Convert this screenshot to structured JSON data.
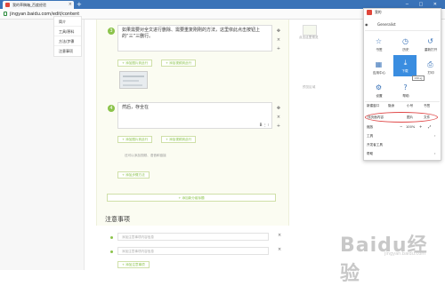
{
  "browser": {
    "tab_title": "我的草稿箱_百度经验",
    "new_tab": "+",
    "url": "jingyan.baidu.com/edit/content",
    "window_controls": "─ □ ✕"
  },
  "left_nav": {
    "items": [
      "简介",
      "工具/原料",
      "方法/步骤",
      "注意事项"
    ]
  },
  "steps": [
    {
      "num": "3",
      "text": "如果需要对全文进行删除、需要重复刚刚的方法，这里依此点击按钮上的“三”三删行。"
    },
    {
      "num": "4",
      "text": "然后，存全在"
    }
  ],
  "buttons": {
    "add_image": "+ 添加图片到此行",
    "add_video": "+ 添加视频到此行",
    "add_step": "+ 添加步骤方法",
    "add_section": "+ 添加新分组标题"
  },
  "image_note": "还可以添加视频、语音和链接",
  "notes": {
    "title": "注意事项",
    "placeholder": "添加注意事项内容信息",
    "add_button": "+ 添加注意事项"
  },
  "right_strip": {
    "label": "点击这里预览",
    "preview": "预览区域"
  },
  "menu": {
    "user": "Generalist",
    "top_label": "我的",
    "grid": [
      {
        "icon": "star-icon",
        "glyph": "☆",
        "label": "书签"
      },
      {
        "icon": "history-icon",
        "glyph": "◷",
        "label": "历史"
      },
      {
        "icon": "reopen-icon",
        "glyph": "↺",
        "label": "重新打开"
      },
      {
        "icon": "app-icon",
        "glyph": "▦",
        "label": "应用中心"
      },
      {
        "icon": "download-icon",
        "glyph": "⤓",
        "label": "下载"
      },
      {
        "icon": "print-icon",
        "glyph": "⎙",
        "label": "打印"
      },
      {
        "icon": "settings-icon",
        "glyph": "⚙",
        "label": "设置"
      },
      {
        "icon": "help-icon",
        "glyph": "?",
        "label": "帮助"
      }
    ],
    "tooltip": "Ctrl+J",
    "row1": [
      "新建窗口",
      "隐身",
      "小号",
      "书签"
    ],
    "row2": [
      "找页面内容",
      "图片",
      "文件"
    ],
    "zoom_label": "缩放",
    "zoom_value": "100%",
    "tools": "工具",
    "dev": "开发者工具",
    "help": "帮助"
  },
  "watermark": "Baidu经验",
  "watermark_sub": "jingyan.baidu.com",
  "colors": {
    "browser_blue": "#3a73b8",
    "accent_green": "#8bc34a",
    "highlight_blue": "#3a8de0",
    "annotation_red": "#e04848"
  }
}
